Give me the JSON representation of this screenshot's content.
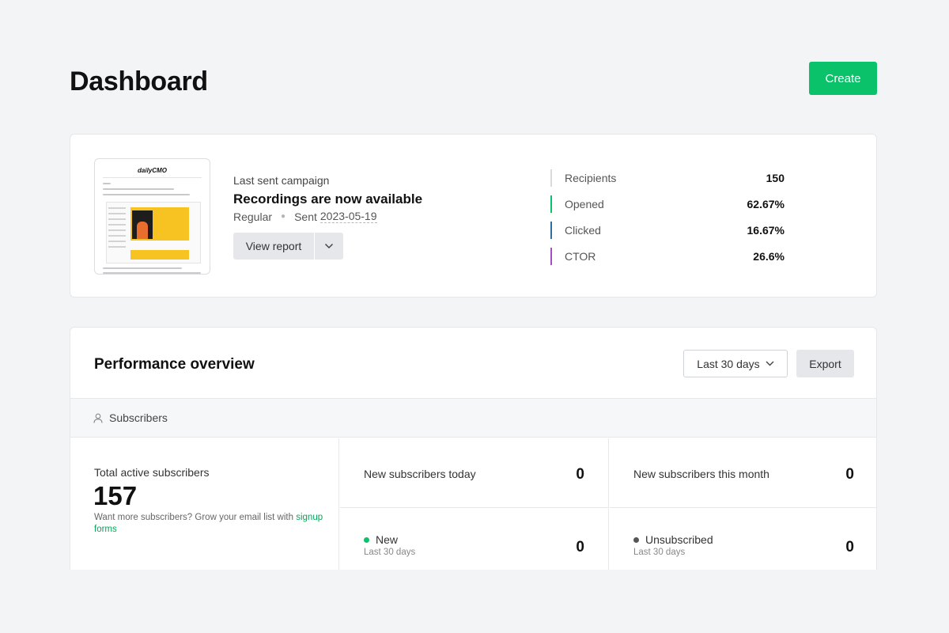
{
  "header": {
    "title": "Dashboard",
    "create_label": "Create"
  },
  "campaign": {
    "thumbnail": {
      "logo": "dailyCMO"
    },
    "section_label": "Last sent campaign",
    "name": "Recordings are now available",
    "type": "Regular",
    "sent_prefix": "Sent",
    "sent_date": "2023-05-19",
    "view_report_label": "View report",
    "stats": [
      {
        "label": "Recipients",
        "value": "150",
        "color": "#d9dadd"
      },
      {
        "label": "Opened",
        "value": "62.67%",
        "color": "#09c269"
      },
      {
        "label": "Clicked",
        "value": "16.67%",
        "color": "#2e6fa3"
      },
      {
        "label": "CTOR",
        "value": "26.6%",
        "color": "#a24fc2"
      }
    ]
  },
  "performance": {
    "title": "Performance overview",
    "range_label": "Last 30 days",
    "export_label": "Export",
    "section_label": "Subscribers",
    "total_label": "Total active subscribers",
    "total_value": "157",
    "grow_text": "Want more subscribers? Grow your email list with",
    "grow_link": "signup forms",
    "today_label": "New subscribers today",
    "today_value": "0",
    "month_label": "New subscribers this month",
    "month_value": "0",
    "new_label": "New",
    "new_sub": "Last 30 days",
    "new_value": "0",
    "new_color": "#09c269",
    "unsub_label": "Unsubscribed",
    "unsub_sub": "Last 30 days",
    "unsub_value": "0",
    "unsub_color": "#555555"
  }
}
